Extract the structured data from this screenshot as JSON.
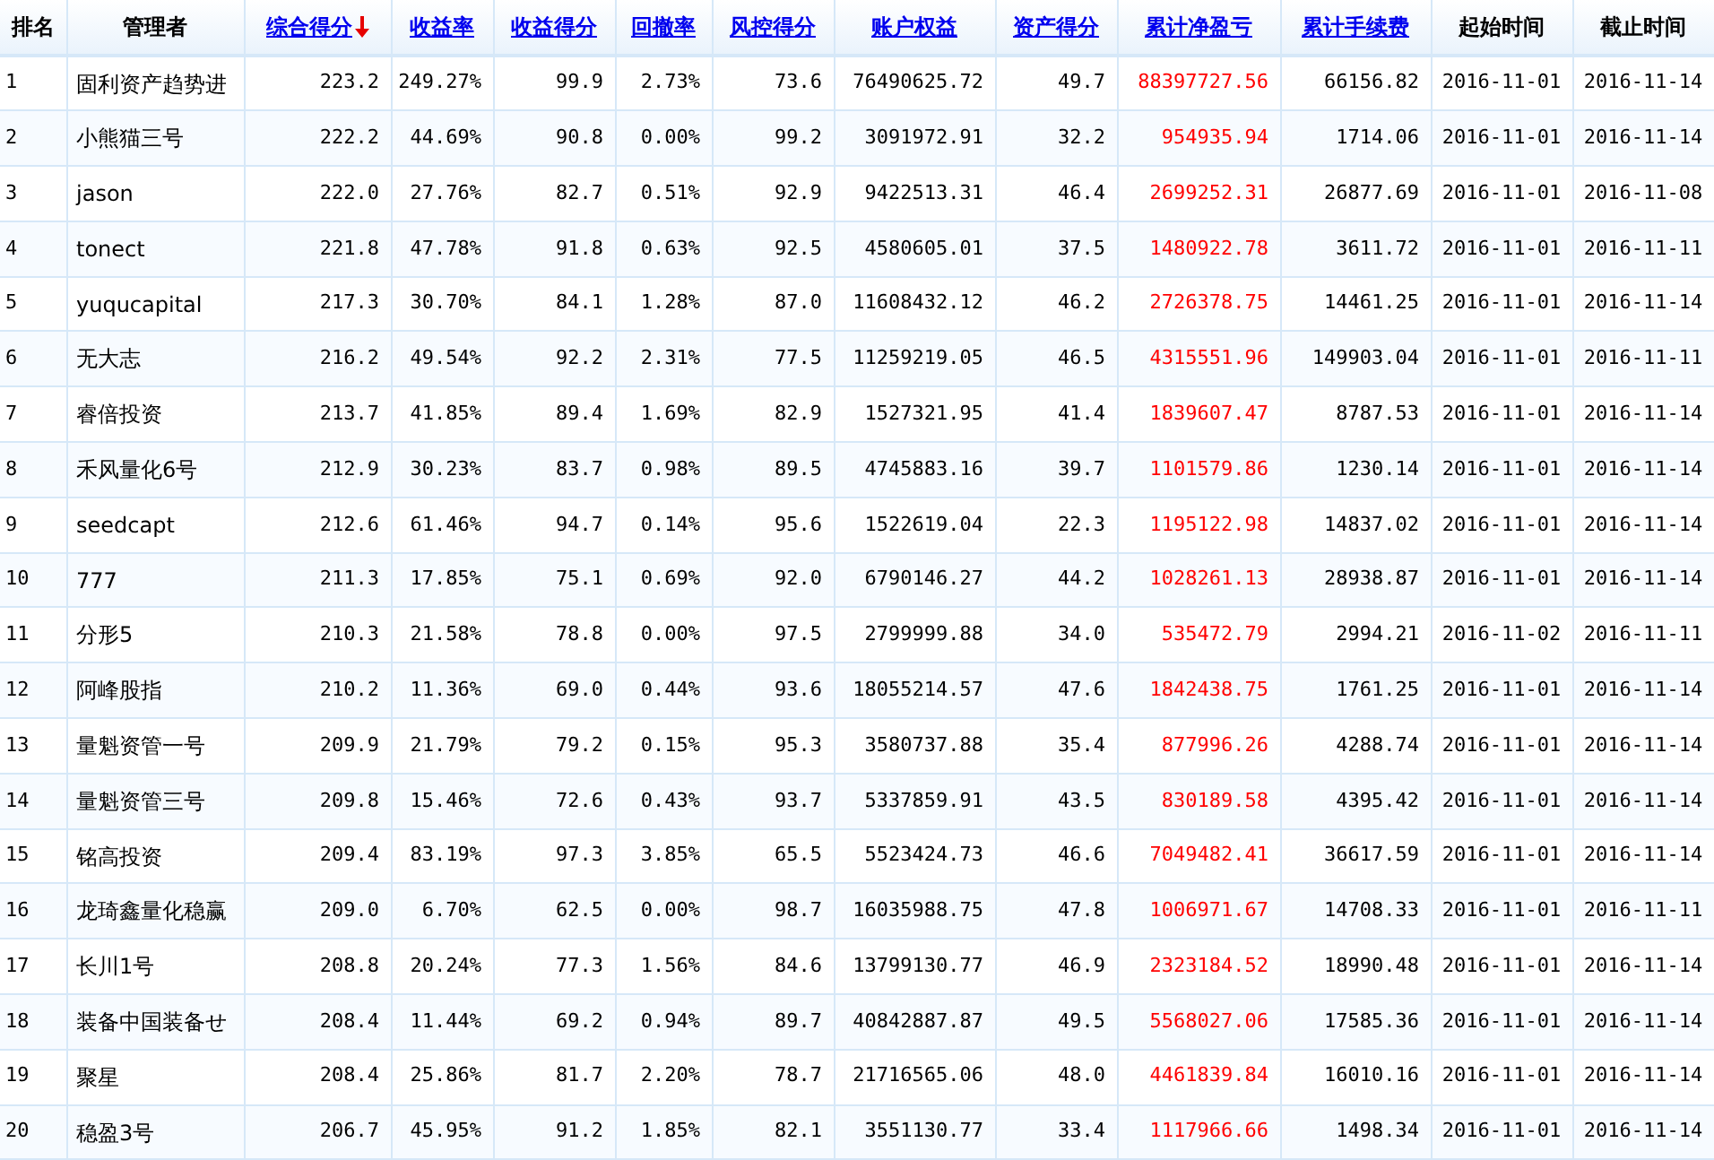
{
  "table": {
    "columns": [
      {
        "label": "排名",
        "kind": "text",
        "link": false,
        "sorted": false,
        "highlight": false
      },
      {
        "label": "管理者",
        "kind": "name",
        "link": false,
        "sorted": false,
        "highlight": false
      },
      {
        "label": "综合得分",
        "kind": "number",
        "link": true,
        "sorted": true,
        "highlight": false
      },
      {
        "label": "收益率",
        "kind": "number",
        "link": true,
        "sorted": false,
        "highlight": false
      },
      {
        "label": "收益得分",
        "kind": "number",
        "link": true,
        "sorted": false,
        "highlight": false
      },
      {
        "label": "回撤率",
        "kind": "number",
        "link": true,
        "sorted": false,
        "highlight": false
      },
      {
        "label": "风控得分",
        "kind": "number",
        "link": true,
        "sorted": false,
        "highlight": false
      },
      {
        "label": "账户权益",
        "kind": "number",
        "link": true,
        "sorted": false,
        "highlight": false
      },
      {
        "label": "资产得分",
        "kind": "number",
        "link": true,
        "sorted": false,
        "highlight": false
      },
      {
        "label": "累计净盈亏",
        "kind": "number",
        "link": true,
        "sorted": false,
        "highlight": true
      },
      {
        "label": "累计手续费",
        "kind": "number",
        "link": true,
        "sorted": false,
        "highlight": false
      },
      {
        "label": "起始时间",
        "kind": "date",
        "link": false,
        "sorted": false,
        "highlight": false
      },
      {
        "label": "截止时间",
        "kind": "date",
        "link": false,
        "sorted": false,
        "highlight": false
      }
    ],
    "rows": [
      [
        "1",
        "固利资产趋势进",
        "223.2",
        "249.27%",
        "99.9",
        "2.73%",
        "73.6",
        "76490625.72",
        "49.7",
        "88397727.56",
        "66156.82",
        "2016-11-01",
        "2016-11-14"
      ],
      [
        "2",
        "小熊猫三号",
        "222.2",
        "44.69%",
        "90.8",
        "0.00%",
        "99.2",
        "3091972.91",
        "32.2",
        "954935.94",
        "1714.06",
        "2016-11-01",
        "2016-11-14"
      ],
      [
        "3",
        "jason",
        "222.0",
        "27.76%",
        "82.7",
        "0.51%",
        "92.9",
        "9422513.31",
        "46.4",
        "2699252.31",
        "26877.69",
        "2016-11-01",
        "2016-11-08"
      ],
      [
        "4",
        "tonect",
        "221.8",
        "47.78%",
        "91.8",
        "0.63%",
        "92.5",
        "4580605.01",
        "37.5",
        "1480922.78",
        "3611.72",
        "2016-11-01",
        "2016-11-11"
      ],
      [
        "5",
        "yuqucapital",
        "217.3",
        "30.70%",
        "84.1",
        "1.28%",
        "87.0",
        "11608432.12",
        "46.2",
        "2726378.75",
        "14461.25",
        "2016-11-01",
        "2016-11-14"
      ],
      [
        "6",
        "无大志",
        "216.2",
        "49.54%",
        "92.2",
        "2.31%",
        "77.5",
        "11259219.05",
        "46.5",
        "4315551.96",
        "149903.04",
        "2016-11-01",
        "2016-11-11"
      ],
      [
        "7",
        "睿倍投资",
        "213.7",
        "41.85%",
        "89.4",
        "1.69%",
        "82.9",
        "1527321.95",
        "41.4",
        "1839607.47",
        "8787.53",
        "2016-11-01",
        "2016-11-14"
      ],
      [
        "8",
        "禾风量化6号",
        "212.9",
        "30.23%",
        "83.7",
        "0.98%",
        "89.5",
        "4745883.16",
        "39.7",
        "1101579.86",
        "1230.14",
        "2016-11-01",
        "2016-11-14"
      ],
      [
        "9",
        "seedcapt",
        "212.6",
        "61.46%",
        "94.7",
        "0.14%",
        "95.6",
        "1522619.04",
        "22.3",
        "1195122.98",
        "14837.02",
        "2016-11-01",
        "2016-11-14"
      ],
      [
        "10",
        "777",
        "211.3",
        "17.85%",
        "75.1",
        "0.69%",
        "92.0",
        "6790146.27",
        "44.2",
        "1028261.13",
        "28938.87",
        "2016-11-01",
        "2016-11-14"
      ],
      [
        "11",
        "分形5",
        "210.3",
        "21.58%",
        "78.8",
        "0.00%",
        "97.5",
        "2799999.88",
        "34.0",
        "535472.79",
        "2994.21",
        "2016-11-02",
        "2016-11-11"
      ],
      [
        "12",
        "阿峰股指",
        "210.2",
        "11.36%",
        "69.0",
        "0.44%",
        "93.6",
        "18055214.57",
        "47.6",
        "1842438.75",
        "1761.25",
        "2016-11-01",
        "2016-11-14"
      ],
      [
        "13",
        "量魁资管一号",
        "209.9",
        "21.79%",
        "79.2",
        "0.15%",
        "95.3",
        "3580737.88",
        "35.4",
        "877996.26",
        "4288.74",
        "2016-11-01",
        "2016-11-14"
      ],
      [
        "14",
        "量魁资管三号",
        "209.8",
        "15.46%",
        "72.6",
        "0.43%",
        "93.7",
        "5337859.91",
        "43.5",
        "830189.58",
        "4395.42",
        "2016-11-01",
        "2016-11-14"
      ],
      [
        "15",
        "铭高投资",
        "209.4",
        "83.19%",
        "97.3",
        "3.85%",
        "65.5",
        "5523424.73",
        "46.6",
        "7049482.41",
        "36617.59",
        "2016-11-01",
        "2016-11-14"
      ],
      [
        "16",
        "龙琦鑫量化稳赢",
        "209.0",
        "6.70%",
        "62.5",
        "0.00%",
        "98.7",
        "16035988.75",
        "47.8",
        "1006971.67",
        "14708.33",
        "2016-11-01",
        "2016-11-11"
      ],
      [
        "17",
        "长川1号",
        "208.8",
        "20.24%",
        "77.3",
        "1.56%",
        "84.6",
        "13799130.77",
        "46.9",
        "2323184.52",
        "18990.48",
        "2016-11-01",
        "2016-11-14"
      ],
      [
        "18",
        "装备中国装备せ",
        "208.4",
        "11.44%",
        "69.2",
        "0.94%",
        "89.7",
        "40842887.87",
        "49.5",
        "5568027.06",
        "17585.36",
        "2016-11-01",
        "2016-11-14"
      ],
      [
        "19",
        "聚星",
        "208.4",
        "25.86%",
        "81.7",
        "2.20%",
        "78.7",
        "21716565.06",
        "48.0",
        "4461839.84",
        "16010.16",
        "2016-11-01",
        "2016-11-14"
      ],
      [
        "20",
        "稳盈3号",
        "206.7",
        "45.95%",
        "91.2",
        "1.85%",
        "82.1",
        "3551130.77",
        "33.4",
        "1117966.66",
        "1498.34",
        "2016-11-01",
        "2016-11-14"
      ]
    ]
  }
}
